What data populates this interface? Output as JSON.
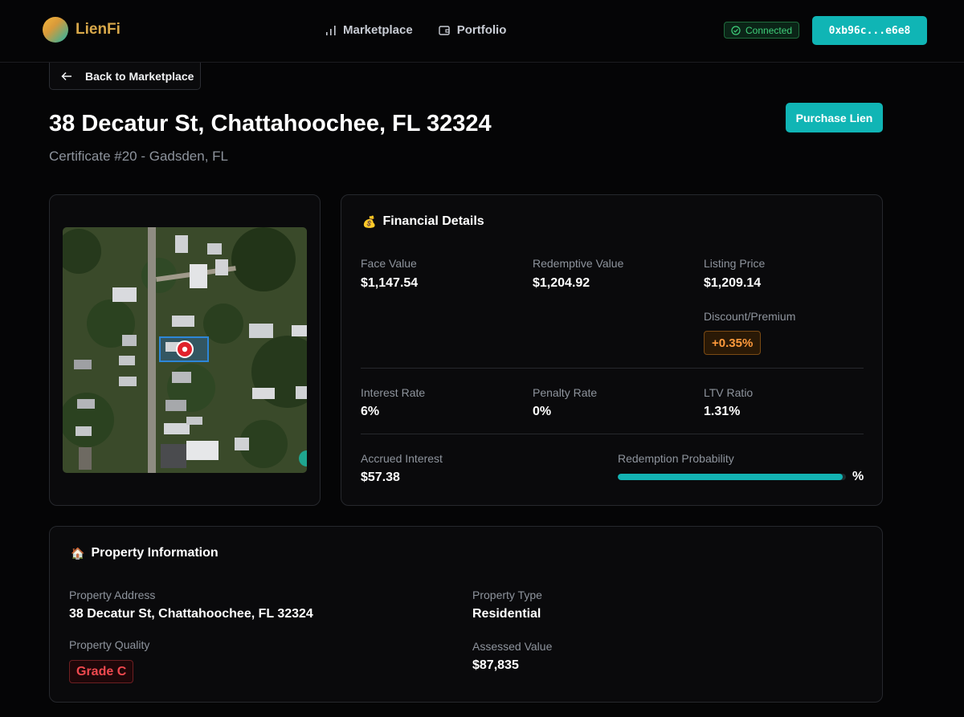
{
  "header": {
    "logo_text": "LienFi",
    "nav": [
      {
        "label": "Marketplace",
        "icon": "bar-chart-icon"
      },
      {
        "label": "Portfolio",
        "icon": "wallet-icon"
      }
    ],
    "status_label": "Connected",
    "wallet_address": "0xb96c...e6e8"
  },
  "page": {
    "back_label": "Back to Marketplace",
    "title": "38 Decatur St, Chattahoochee, FL 32324",
    "subtitle": "Certificate #20 - Gadsden, FL",
    "purchase_label": "Purchase Lien"
  },
  "financial": {
    "heading_icon": "💰",
    "heading": "Financial Details",
    "face_value_label": "Face Value",
    "face_value": "$1,147.54",
    "redemptive_value_label": "Redemptive Value",
    "redemptive_value": "$1,204.92",
    "listing_price_label": "Listing Price",
    "listing_price": "$1,209.14",
    "discount_label": "Discount/Premium",
    "discount_value": "+0.35%",
    "interest_rate_label": "Interest Rate",
    "interest_rate": "6%",
    "penalty_rate_label": "Penalty Rate",
    "penalty_rate": "0%",
    "ltv_label": "LTV Ratio",
    "ltv_value": "1.31%",
    "accrued_label": "Accrued Interest",
    "accrued_value": "$57.38",
    "redemption_label": "Redemption Probability",
    "redemption_fraction": 0.985,
    "redemption_pct_text": "%"
  },
  "property": {
    "heading_icon": "🏠",
    "heading": "Property Information",
    "address_label": "Property Address",
    "address_value": "38 Decatur St, Chattahoochee, FL 32324",
    "type_label": "Property Type",
    "type_value": "Residential",
    "quality_label": "Property Quality",
    "quality_value": "Grade C",
    "assessed_label": "Assessed Value",
    "assessed_value": "$87,835"
  },
  "colors": {
    "accent": "#10b5b5",
    "connected": "#3fcf7a",
    "premium": "#ff9a3c",
    "grade": "#f0494f"
  }
}
